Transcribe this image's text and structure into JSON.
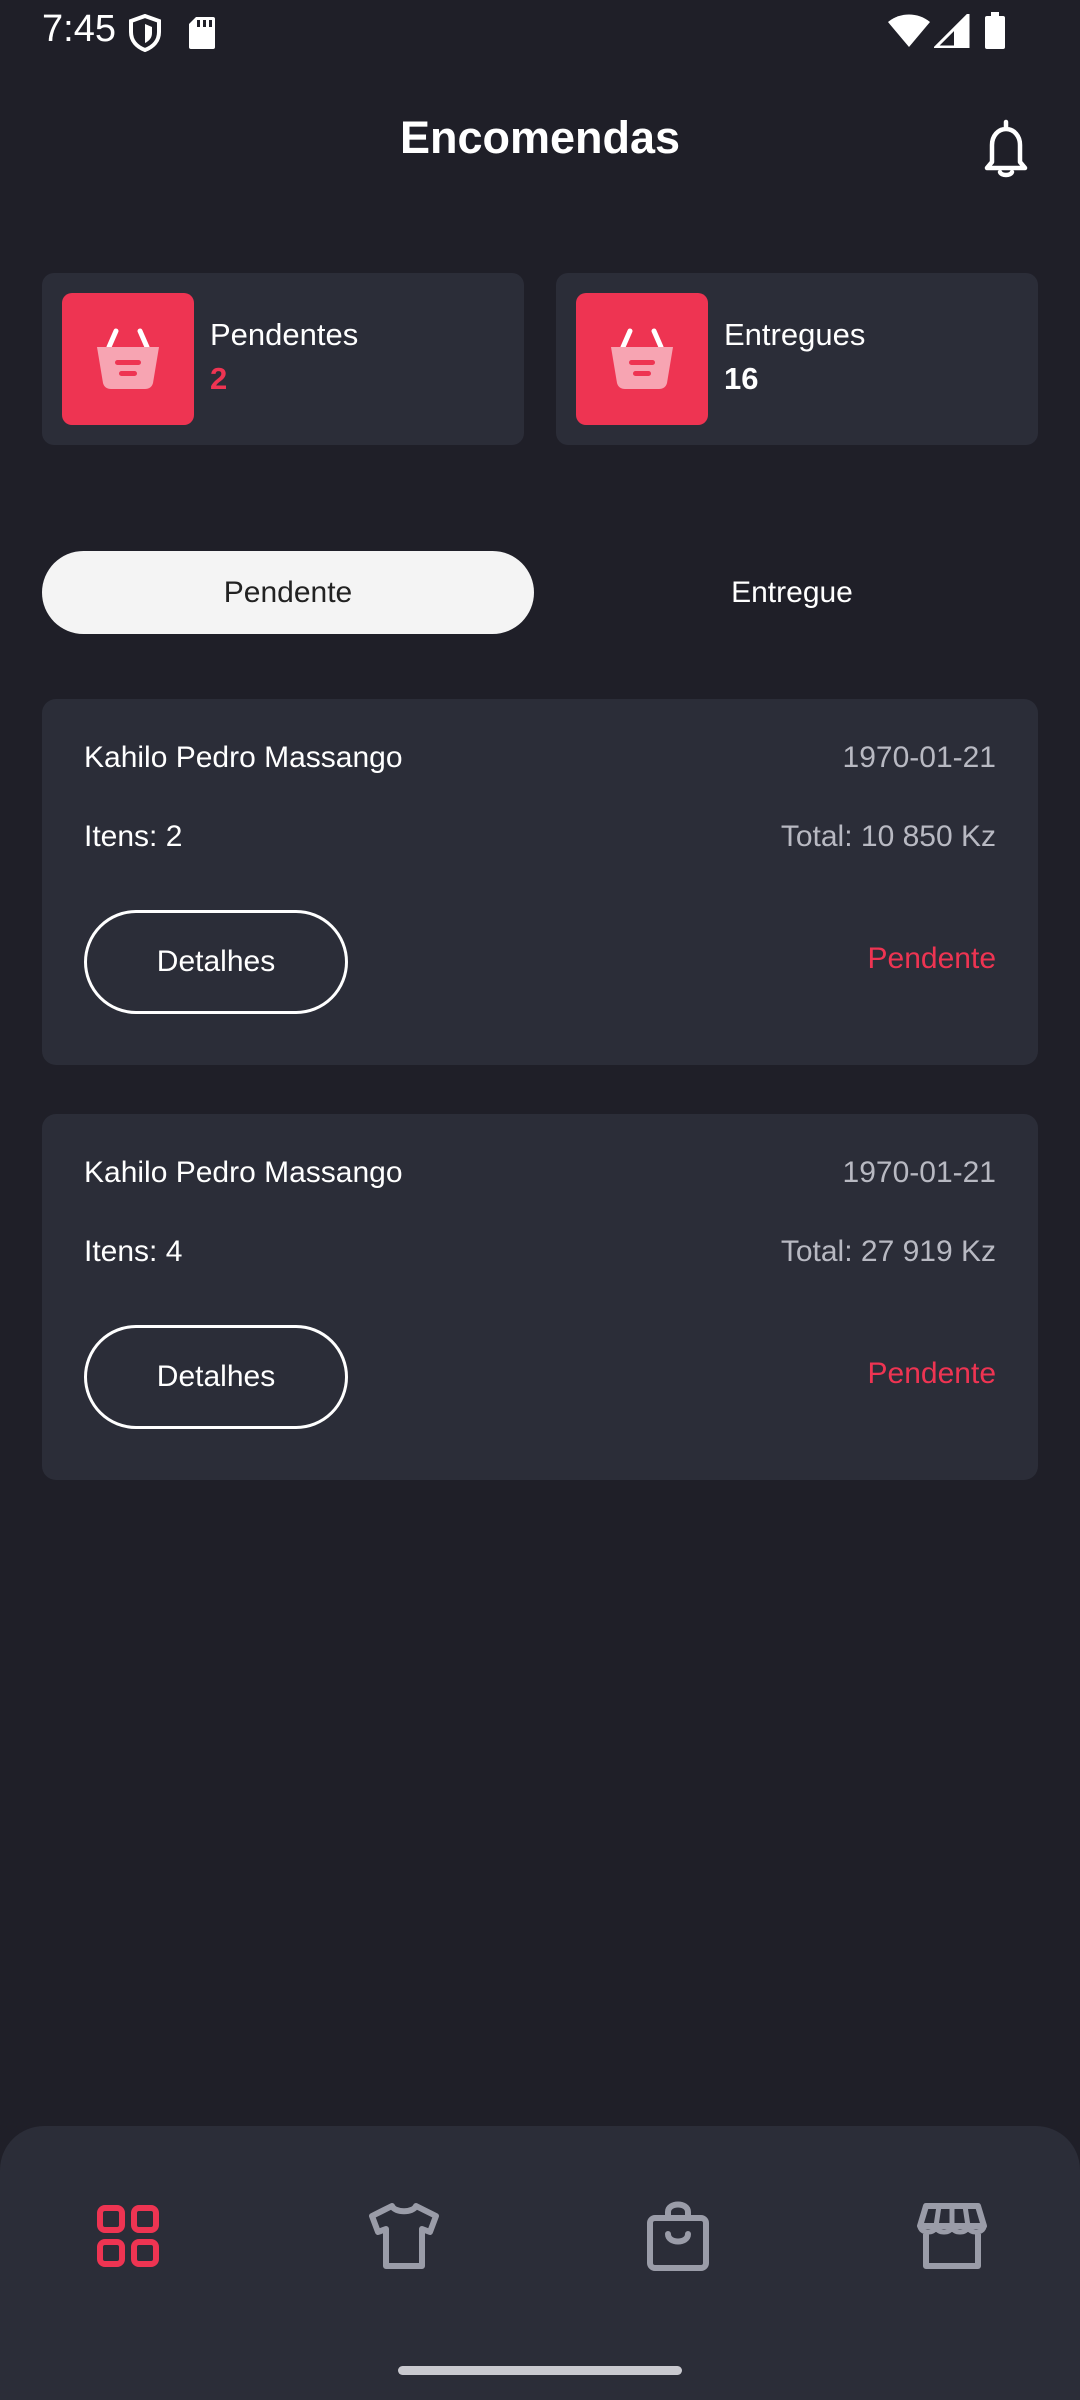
{
  "status_bar": {
    "time": "7:45",
    "icons": [
      "shield-icon",
      "sd-card-icon",
      "wifi-icon",
      "signal-icon",
      "battery-icon"
    ]
  },
  "header": {
    "title": "Encomendas",
    "bell_icon": "bell-icon"
  },
  "summary": [
    {
      "label": "Pendentes",
      "count": "2",
      "icon": "basket-icon"
    },
    {
      "label": "Entregues",
      "count": "16",
      "icon": "basket-icon"
    }
  ],
  "tabs": [
    {
      "label": "Pendente",
      "active": true
    },
    {
      "label": "Entregue",
      "active": false
    }
  ],
  "orders": [
    {
      "customer": "Kahilo Pedro Massango",
      "date": "1970-01-21",
      "items": "Itens: 2",
      "total": "Total: 10 850 Kz",
      "details_label": "Detalhes",
      "status": "Pendente"
    },
    {
      "customer": "Kahilo Pedro Massango",
      "date": "1970-01-21",
      "items": "Itens: 4",
      "total": "Total: 27 919 Kz",
      "details_label": "Detalhes",
      "status": "Pendente"
    }
  ],
  "bottom_nav": [
    {
      "icon": "grid-icon",
      "active": true
    },
    {
      "icon": "tshirt-icon",
      "active": false
    },
    {
      "icon": "shopping-bag-icon",
      "active": false
    },
    {
      "icon": "store-icon",
      "active": false
    }
  ],
  "colors": {
    "background": "#1f1f28",
    "card": "#2b2d38",
    "accent": "#ee3452",
    "muted_text": "#b8b9c2",
    "inactive_icon": "#9a9ca8"
  }
}
